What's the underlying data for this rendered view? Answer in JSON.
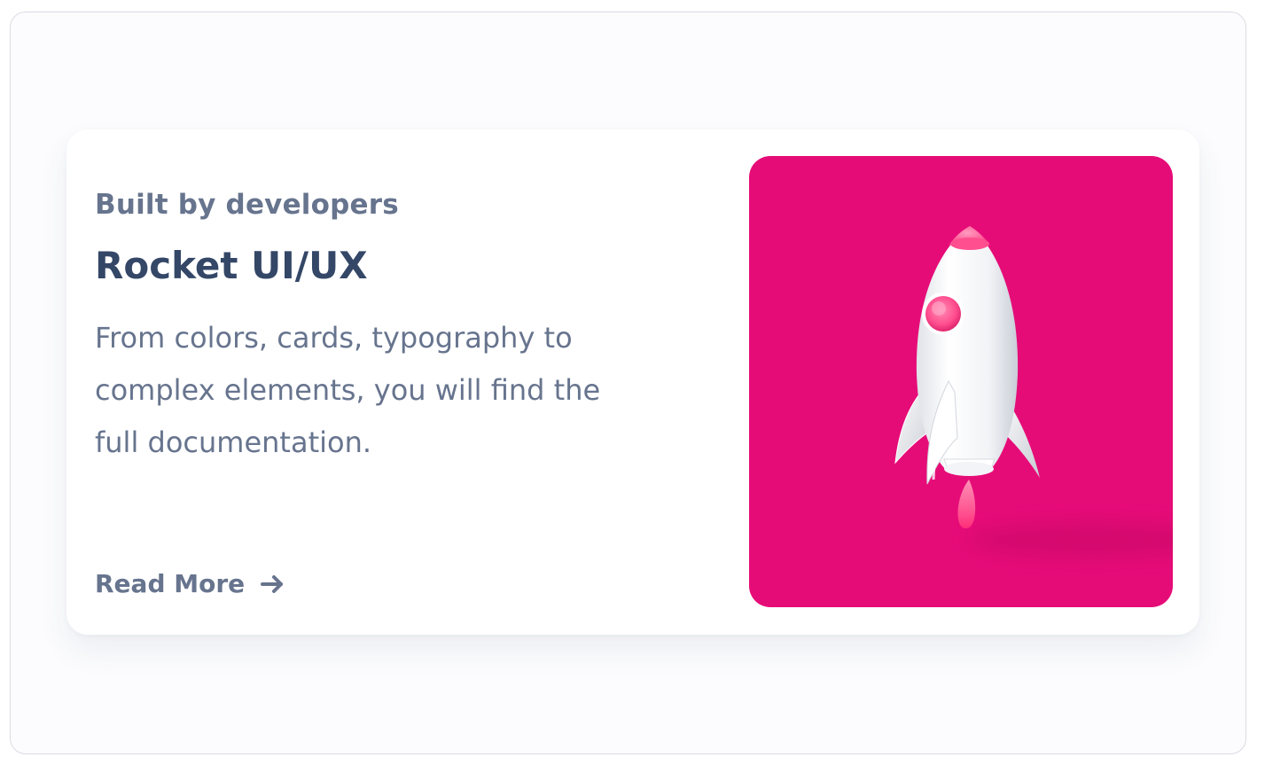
{
  "card": {
    "eyebrow": "Built by developers",
    "title": "Rocket UI/UX",
    "description": "From colors, cards, typography to complex elements, you will find the full documentation.",
    "cta_label": "Read More"
  },
  "icons": {
    "cta_icon": "arrow-right-icon",
    "image": "rocket-illustration"
  },
  "colors": {
    "hero_background": "#e60c78",
    "title": "#344767",
    "muted_text": "#67748e"
  }
}
